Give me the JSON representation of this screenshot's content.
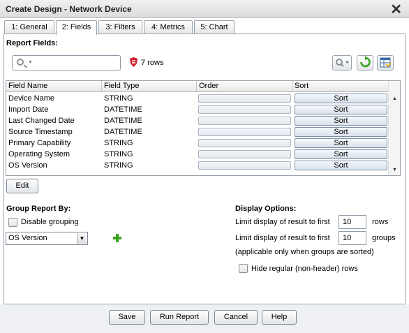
{
  "window": {
    "title": "Create Design - Network Device",
    "close_glyph": "✕"
  },
  "tabs": [
    {
      "label": "1: General"
    },
    {
      "label": "2: Fields"
    },
    {
      "label": "3: Filters"
    },
    {
      "label": "4: Metrics"
    },
    {
      "label": "5: Chart"
    }
  ],
  "active_tab": "2: Fields",
  "report_fields": {
    "heading": "Report Fields:",
    "search": {
      "value": "",
      "placeholder": ""
    },
    "rows_count": "7 rows",
    "columns": [
      "Field Name",
      "Field Type",
      "Order",
      "Sort"
    ],
    "rows": [
      {
        "name": "Device Name",
        "type": "STRING",
        "sort": "Sort"
      },
      {
        "name": "Import Date",
        "type": "DATETIME",
        "sort": "Sort"
      },
      {
        "name": "Last Changed Date",
        "type": "DATETIME",
        "sort": "Sort"
      },
      {
        "name": "Source Timestamp",
        "type": "DATETIME",
        "sort": "Sort"
      },
      {
        "name": "Primary Capability",
        "type": "STRING",
        "sort": "Sort"
      },
      {
        "name": "Operating System",
        "type": "STRING",
        "sort": "Sort"
      },
      {
        "name": "OS Version",
        "type": "STRING",
        "sort": "Sort"
      }
    ],
    "edit_label": "Edit"
  },
  "group_by": {
    "heading": "Group Report By:",
    "disable_label": "Disable grouping",
    "disable_checked": false,
    "select_value": "OS Version"
  },
  "display_options": {
    "heading": "Display Options:",
    "limit_rows_label": "Limit display of result to first",
    "limit_rows_value": "10",
    "limit_rows_unit": "rows",
    "limit_groups_label": "Limit display of result to first",
    "limit_groups_value": "10",
    "limit_groups_unit": "groups",
    "note": "(applicable only when groups are sorted)",
    "hide_label": "Hide regular (non-header) rows",
    "hide_checked": false
  },
  "footer": {
    "save": "Save",
    "run": "Run Report",
    "cancel": "Cancel",
    "help": "Help"
  },
  "icons": {
    "search": "search-icon",
    "rows": "rows-shield-icon",
    "search_options": "search-options-icon",
    "refresh": "refresh-icon",
    "columns": "column-chooser-icon",
    "add": "add-plus-icon",
    "close": "close-icon"
  },
  "colors": {
    "accent_green": "#3aa51e",
    "rows_icon_red": "#d4202a"
  }
}
